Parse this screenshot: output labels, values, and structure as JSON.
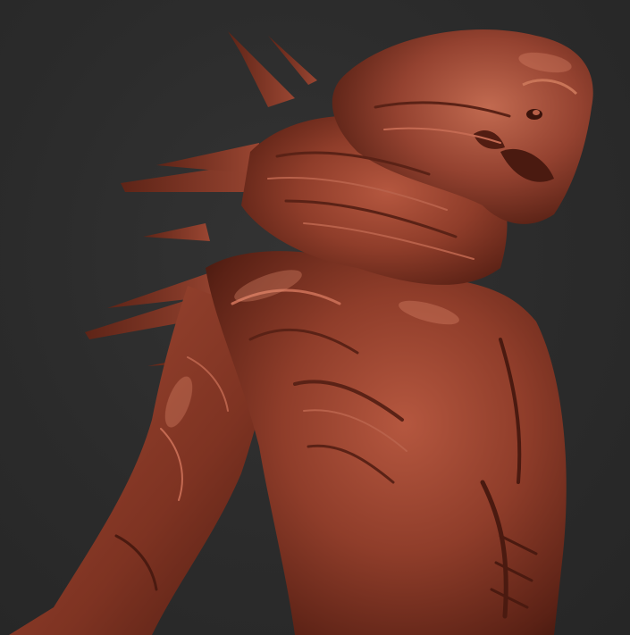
{
  "scene": {
    "colors": {
      "background": "#2a2a2a",
      "clay_base": "#8a3a28",
      "clay_light": "#c46a52",
      "clay_shadow": "#4a1a10"
    }
  }
}
